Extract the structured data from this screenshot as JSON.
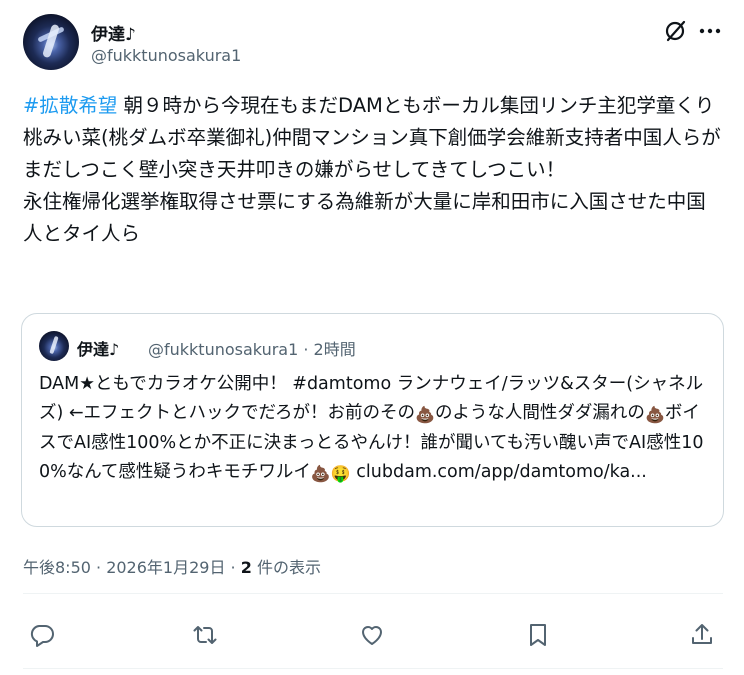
{
  "author": {
    "display_name": "伊達♪",
    "handle": "@fukktunosakura1"
  },
  "tweet": {
    "hashtag": "#拡散希望",
    "body": " 朝９時から今現在もまだDAMともボーカル集団リンチ主犯学童くり桃みい菜(桃ダムボ卒業御礼)仲間マンション真下創価学会維新支持者中国人らがまだしつこく壁小突き天井叩きの嫌がらせしてきてしつこい！\n永住権帰化選挙権取得させ票にする為維新が大量に岸和田市に入国させた中国人とタイ人ら"
  },
  "quoted": {
    "display_name": "伊達♪",
    "meta": "@fukktunosakura1 · 2時間",
    "text_part1": "DAM★ともでカラオケ公開中！ #damtomo ランナウェイ/ラッツ&スター(シャネルズ) ←エフェクトとハックでだろが！お前のその",
    "text_part2": "のような人間性ダダ漏れの",
    "text_part3": "ボイスでAI感性100%とか不正に決まっとるやんけ！誰が聞いても汚い醜い声でAI感性100%なんて感性疑うわキモチワルイ",
    "text_part4": " clubdam.com/app/damtomo/ka...",
    "emoji_poop": "💩",
    "emoji_money": "🤑"
  },
  "footer": {
    "time": "午後8:50 · 2026年1月29日 · ",
    "views_count": "2",
    "views_label": " 件の表示"
  },
  "icons": [
    "grok-icon",
    "more-icon",
    "reply-icon",
    "retweet-icon",
    "like-icon",
    "bookmark-icon",
    "share-icon"
  ],
  "colors": {
    "accent": "#1d9bf0",
    "secondary_text": "#536471",
    "border": "#cfd9de"
  }
}
